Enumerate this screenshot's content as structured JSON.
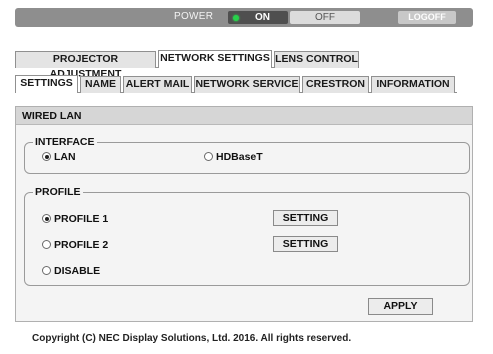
{
  "topbar": {
    "power_label": "POWER",
    "on_label": "ON",
    "off_label": "OFF",
    "logoff_label": "LOGOFF",
    "led_color": "#27d24a",
    "power_state": "on"
  },
  "main_tabs": [
    {
      "label": "PROJECTOR ADJUSTMENT",
      "active": false
    },
    {
      "label": "NETWORK SETTINGS",
      "active": true
    },
    {
      "label": "LENS CONTROL",
      "active": false
    }
  ],
  "sub_tabs": [
    {
      "label": "SETTINGS",
      "active": true
    },
    {
      "label": "NAME",
      "active": false
    },
    {
      "label": "ALERT MAIL",
      "active": false
    },
    {
      "label": "NETWORK SERVICE",
      "active": false
    },
    {
      "label": "CRESTRON",
      "active": false
    },
    {
      "label": "INFORMATION",
      "active": false
    }
  ],
  "panel": {
    "title": "WIRED LAN",
    "interface": {
      "legend": "INTERFACE",
      "options": [
        {
          "label": "LAN",
          "selected": true
        },
        {
          "label": "HDBaseT",
          "selected": false
        }
      ]
    },
    "profile": {
      "legend": "PROFILE",
      "options": [
        {
          "label": "PROFILE 1",
          "selected": true,
          "button": "SETTING"
        },
        {
          "label": "PROFILE 2",
          "selected": false,
          "button": "SETTING"
        },
        {
          "label": "DISABLE",
          "selected": false
        }
      ]
    },
    "apply_label": "APPLY"
  },
  "footer": {
    "copyright": "Copyright (C) NEC Display Solutions, Ltd. 2016. All rights reserved."
  }
}
